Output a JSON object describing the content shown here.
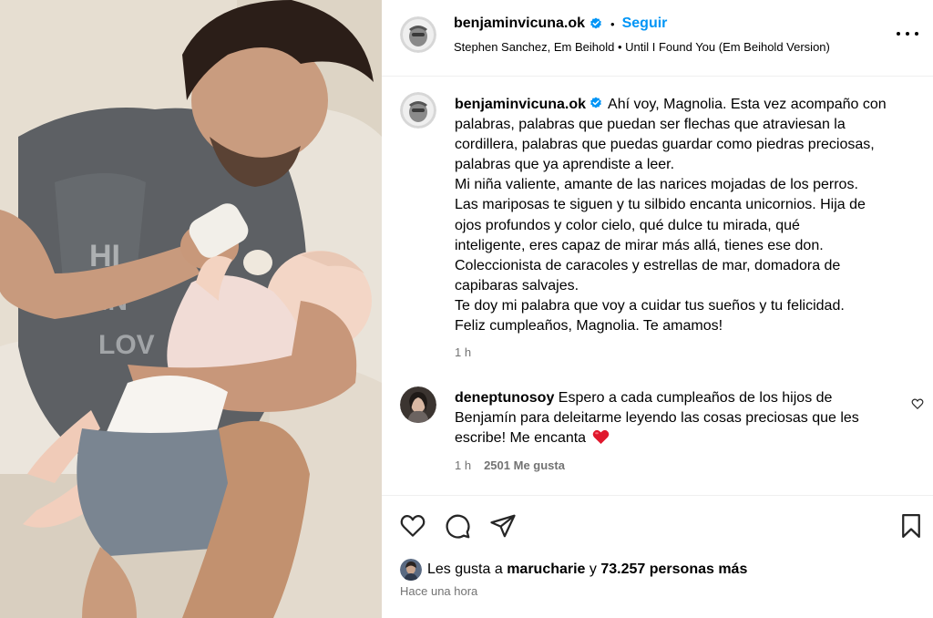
{
  "post": {
    "username": "benjaminvicuna.ok",
    "follow_label": "Seguir",
    "audio": "Stephen Sanchez, Em Beihold • Until I Found You (Em Beihold Version)",
    "caption_lines": [
      "Ahí voy, Magnolia. Esta vez acompaño con",
      "palabras, palabras que puedan ser flechas que atraviesan la",
      "cordillera, palabras que puedas guardar como piedras preciosas,",
      "palabras que ya aprendiste a leer.",
      "Mi niña valiente, amante de las narices mojadas de los perros.",
      "Las mariposas te siguen y tu silbido encanta unicornios. Hija de",
      "ojos profundos y color cielo, qué dulce tu mirada, qué",
      "inteligente, eres capaz de mirar más allá, tienes ese don.",
      "Coleccionista de caracoles y estrellas de mar, domadora de",
      "capibaras salvajes.",
      "Te doy mi palabra que voy a cuidar tus sueños y tu felicidad.",
      "Feliz cumpleaños, Magnolia. Te amamos!"
    ],
    "caption_time": "1 h",
    "verified_color": "#0095f6"
  },
  "comment": {
    "username": "deneptunosoy",
    "lines": [
      "Espero a cada cumpleaños de los hijos de",
      "Benjamín para deleitarme leyendo las cosas preciosas que les",
      "escribe! Me encanta"
    ],
    "time": "1 h",
    "likes": "2501 Me gusta"
  },
  "footer": {
    "likes_prefix": "Les gusta a",
    "likes_user": "marucharie",
    "likes_join": "y",
    "likes_others": "73.257 personas más",
    "time_ago": "Hace una hora"
  },
  "icons": {
    "header_more": "more-horizontal-icon",
    "comment_like": "heart-outline-icon",
    "like": "heart-outline-icon",
    "comment": "comment-bubble-icon",
    "share": "paper-plane-icon",
    "save": "bookmark-icon"
  },
  "colors": {
    "accent": "#0095f6",
    "secondary_text": "#737373",
    "heart_emoji": "#e0182d"
  }
}
